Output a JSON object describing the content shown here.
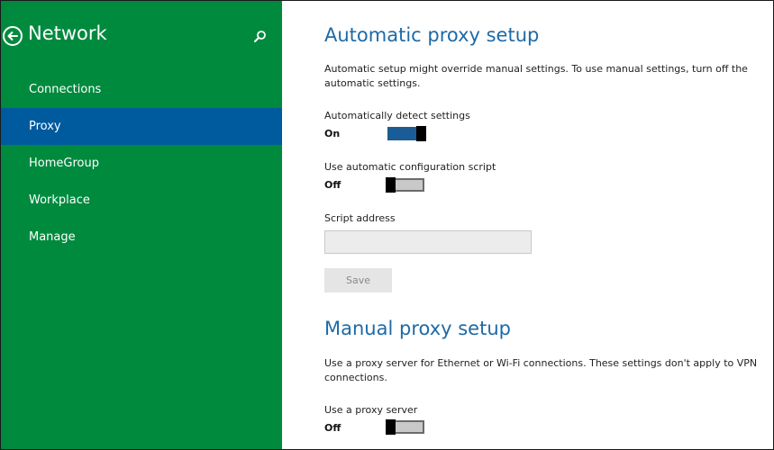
{
  "sidebar": {
    "title": "Network",
    "back_icon": "back-arrow-circle-icon",
    "search_icon": "search-icon",
    "items": [
      {
        "label": "Connections",
        "selected": false
      },
      {
        "label": "Proxy",
        "selected": true
      },
      {
        "label": "HomeGroup",
        "selected": false
      },
      {
        "label": "Workplace",
        "selected": false
      },
      {
        "label": "Manage",
        "selected": false
      }
    ]
  },
  "automatic": {
    "title": "Automatic proxy setup",
    "description": "Automatic setup might override manual settings. To use manual settings, turn off the automatic settings.",
    "detect": {
      "label": "Automatically detect settings",
      "state": "On",
      "on": true
    },
    "script": {
      "label": "Use automatic configuration script",
      "state": "Off",
      "on": false
    },
    "address": {
      "label": "Script address",
      "value": "",
      "placeholder": ""
    },
    "save_label": "Save"
  },
  "manual": {
    "title": "Manual proxy setup",
    "description": "Use a proxy server for Ethernet or Wi-Fi connections. These settings don't apply to VPN connections.",
    "proxy": {
      "label": "Use a proxy server",
      "state": "Off",
      "on": false
    }
  },
  "colors": {
    "sidebar_bg": "#008a3e",
    "selected_bg": "#005a9e",
    "heading": "#1e6aa6",
    "toggle_on": "#1a5c99"
  }
}
